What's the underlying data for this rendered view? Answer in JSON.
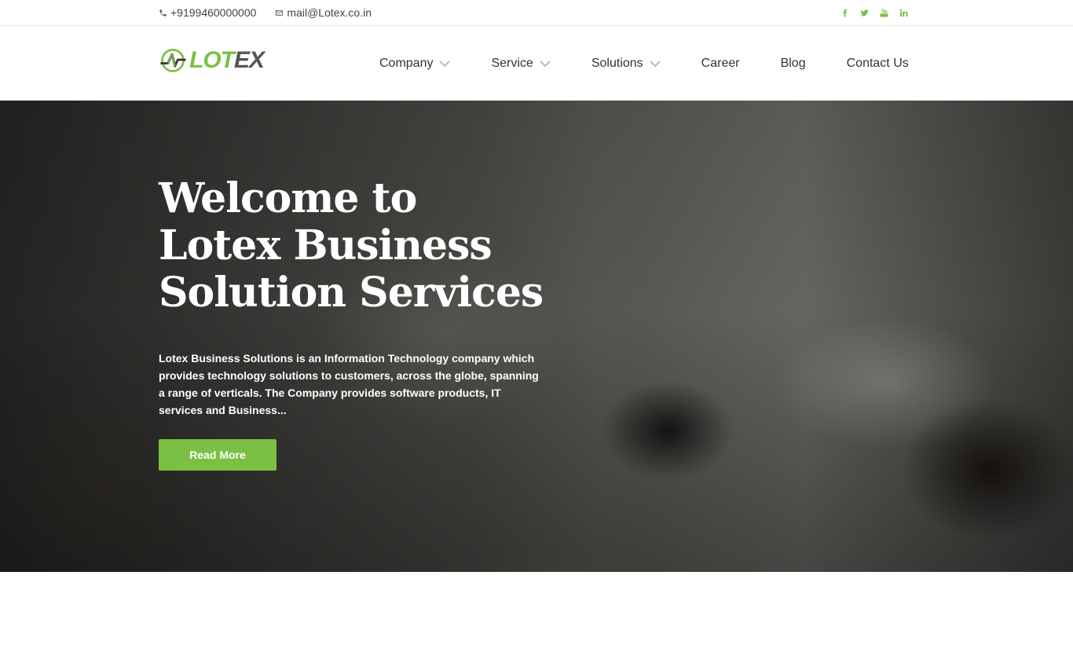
{
  "topbar": {
    "phone": "+9199460000000",
    "email": "mail@Lotex.co.in",
    "social": [
      "facebook-icon",
      "twitter-icon",
      "youtube-icon",
      "linkedin-icon"
    ]
  },
  "brand": {
    "logo_text_green": "LOT",
    "logo_text_dark": "EX",
    "colors": {
      "accent": "#7bc043",
      "dark": "#555555"
    }
  },
  "nav": {
    "company": "Company",
    "service": "Service",
    "solutions": "Solutions",
    "career": "Career",
    "blog": "Blog",
    "contact": "Contact Us"
  },
  "hero": {
    "title_line1": "Welcome to",
    "title_line2": "Lotex Business",
    "title_line3": "Solution Services",
    "description": "Lotex Business Solutions is an Information Technology company which provides technology solutions to customers, across the globe, spanning a range of verticals. The Company provides software products, IT services and Business...",
    "button": "Read More"
  }
}
